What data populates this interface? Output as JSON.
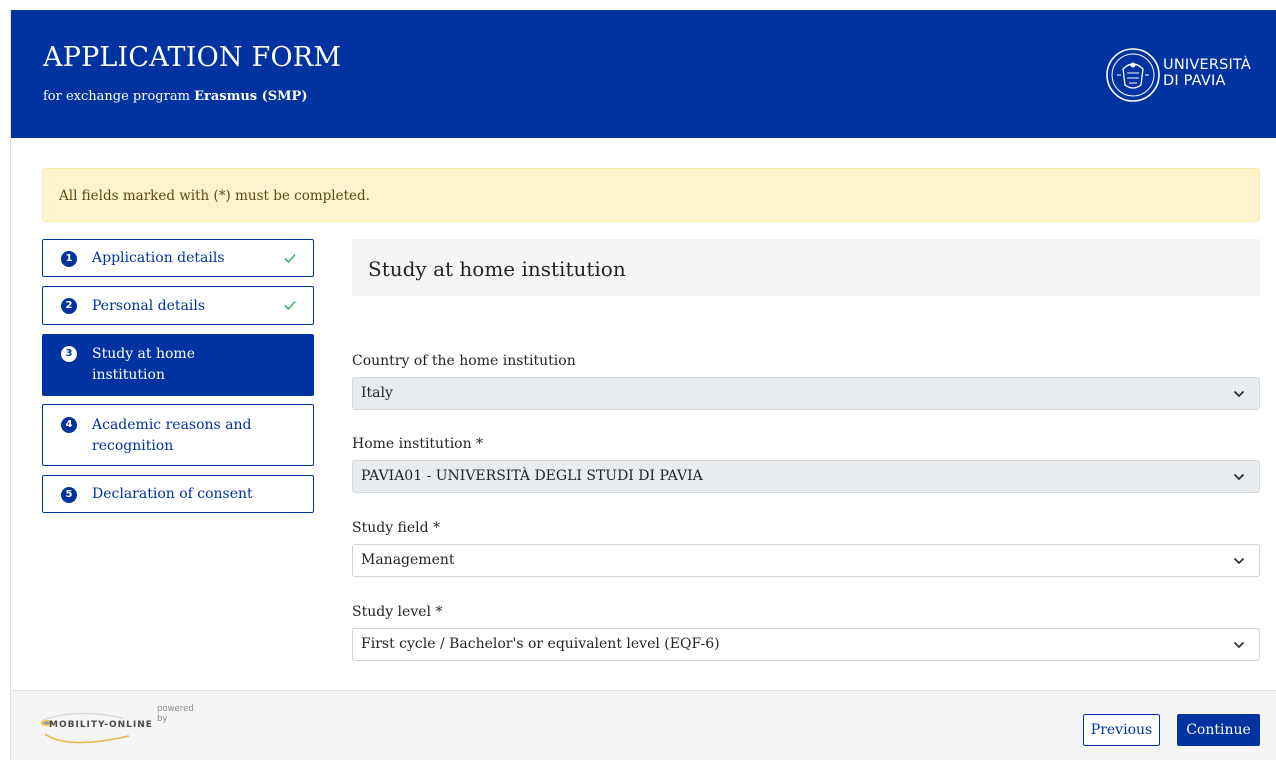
{
  "header": {
    "title": "APPLICATION FORM",
    "subtitle_prefix": "for exchange program",
    "program": "Erasmus (SMP)",
    "university_line1": "UNIVERSITÀ",
    "university_line2": "DI PAVIA"
  },
  "notice": "All fields marked with (*) must be completed.",
  "steps": [
    {
      "number": "1",
      "label": "Application details",
      "completed": true,
      "active": false
    },
    {
      "number": "2",
      "label": "Personal details",
      "completed": true,
      "active": false
    },
    {
      "number": "3",
      "label_line1": "Study at home",
      "label_line2": "institution",
      "completed": false,
      "active": true
    },
    {
      "number": "4",
      "label_line1": "Academic reasons and",
      "label_line2": "recognition",
      "completed": false,
      "active": false
    },
    {
      "number": "5",
      "label": "Declaration of consent",
      "completed": false,
      "active": false
    }
  ],
  "main": {
    "section_title": "Study at home institution",
    "fields": [
      {
        "label": "Country of the home institution",
        "value": "Italy",
        "disabled": true
      },
      {
        "label": "Home institution *",
        "value": "PAVIA01 - UNIVERSITÀ DEGLI STUDI DI PAVIA",
        "disabled": true
      },
      {
        "label": "Study field *",
        "value": "Management",
        "disabled": false
      },
      {
        "label": "Study level *",
        "value": "First cycle / Bachelor's or equivalent level (EQF-6)",
        "disabled": false
      }
    ]
  },
  "footer": {
    "powered_by": "powered by",
    "brand": "MOBILITY-ONLINE",
    "previous_label": "Previous",
    "continue_label": "Continue"
  },
  "colors": {
    "primary": "#0033a0",
    "notice_bg": "#fdf3cd",
    "check": "#3cb371"
  },
  "icons": {
    "check": "check-icon",
    "chevron": "chevron-down-icon",
    "seal": "university-seal-icon"
  }
}
